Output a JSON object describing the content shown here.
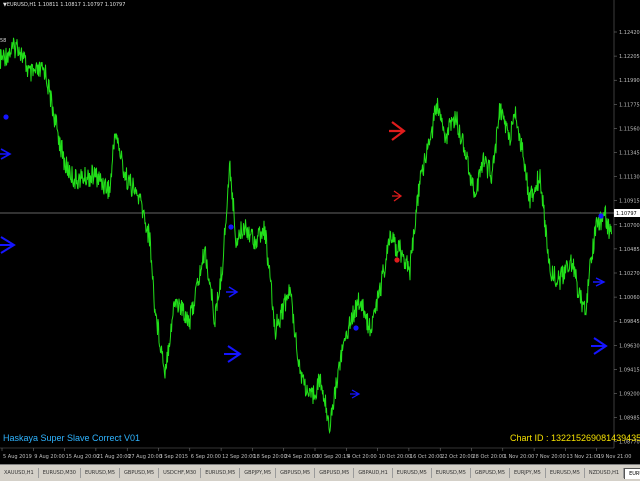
{
  "header": {
    "symbol_line": "▼EURUSD,H1  1.10811 1.10817 1.10797 1.10797"
  },
  "price_axis": {
    "labels": [
      "1.12420",
      "1.12205",
      "1.11990",
      "1.11775",
      "1.11560",
      "1.11345",
      "1.11130",
      "1.10915",
      "1.10700",
      "1.10485",
      "1.10270",
      "1.10060",
      "1.09845",
      "1.09630",
      "1.09415",
      "1.09200",
      "1.08985",
      "1.08770",
      "1.08555"
    ],
    "current_price": "1.10797"
  },
  "time_axis": {
    "labels": [
      "5 Aug 2019",
      "9 Aug 20:00",
      "15 Aug 20:00",
      "21 Aug 20:00",
      "27 Aug 20:00",
      "3 Sep 2015",
      "6 Sep 20:00",
      "12 Sep 20:00",
      "18 Sep 20:00",
      "24 Sep 20:00",
      "30 Sep 20:15",
      "4 Oct 20:00",
      "10 Oct 20:00",
      "16 Oct 20:00",
      "22 Oct 20:00",
      "28 Oct 20:00",
      "1 Nov 20:00",
      "7 Nov 20:00",
      "13 Nov 21:00",
      "19 Nov 21:00"
    ]
  },
  "overlays": {
    "indicator_name": "Haskaya Super Slave Correct V01",
    "chart_id": "Chart ID : 132215269081439435",
    "left_marker": "58"
  },
  "tabs": [
    "XAUUSD,H1",
    "EURUSD,M30",
    "EURUSD,M5",
    "GBPUSD,M5",
    "USDCHF,M30",
    "EURUSD,M5",
    "GBPJPY,M5",
    "GBPUSD,M5",
    "GBPUSD,M5",
    "GBPAUD,H1",
    "EURUSD,M5",
    "EURUSD,M5",
    "GBPUSD,M5",
    "EURJPY,M5",
    "EURUSD,M5",
    "NZDUSD,H1",
    "EURUSD,H1"
  ],
  "active_tab": "EURUSD,H1",
  "colors": {
    "background": "#000000",
    "candles": "#22e01a",
    "buy_arrow": "#1515ff",
    "sell_arrow": "#e01c1c",
    "overlay_text": "#f5e000",
    "indicator_text": "#2fb4ff",
    "price_line": "#c8c8c8"
  },
  "chart_data": {
    "type": "line",
    "symbol": "EURUSD",
    "timeframe": "H1",
    "current_price": 1.10797,
    "ylim": [
      1.0855,
      1.1263
    ],
    "buy_arrows": [
      "left edge, ~1.1093",
      "left edge, ~1.1063",
      "12 Sep area",
      "12 Sep area large",
      "1 Oct area",
      "13 Nov area",
      "19 Nov area large"
    ],
    "sell_arrows": [
      "15 Oct area large",
      "15 Oct area small"
    ],
    "dots": {
      "blue": 4,
      "red": 1
    }
  }
}
